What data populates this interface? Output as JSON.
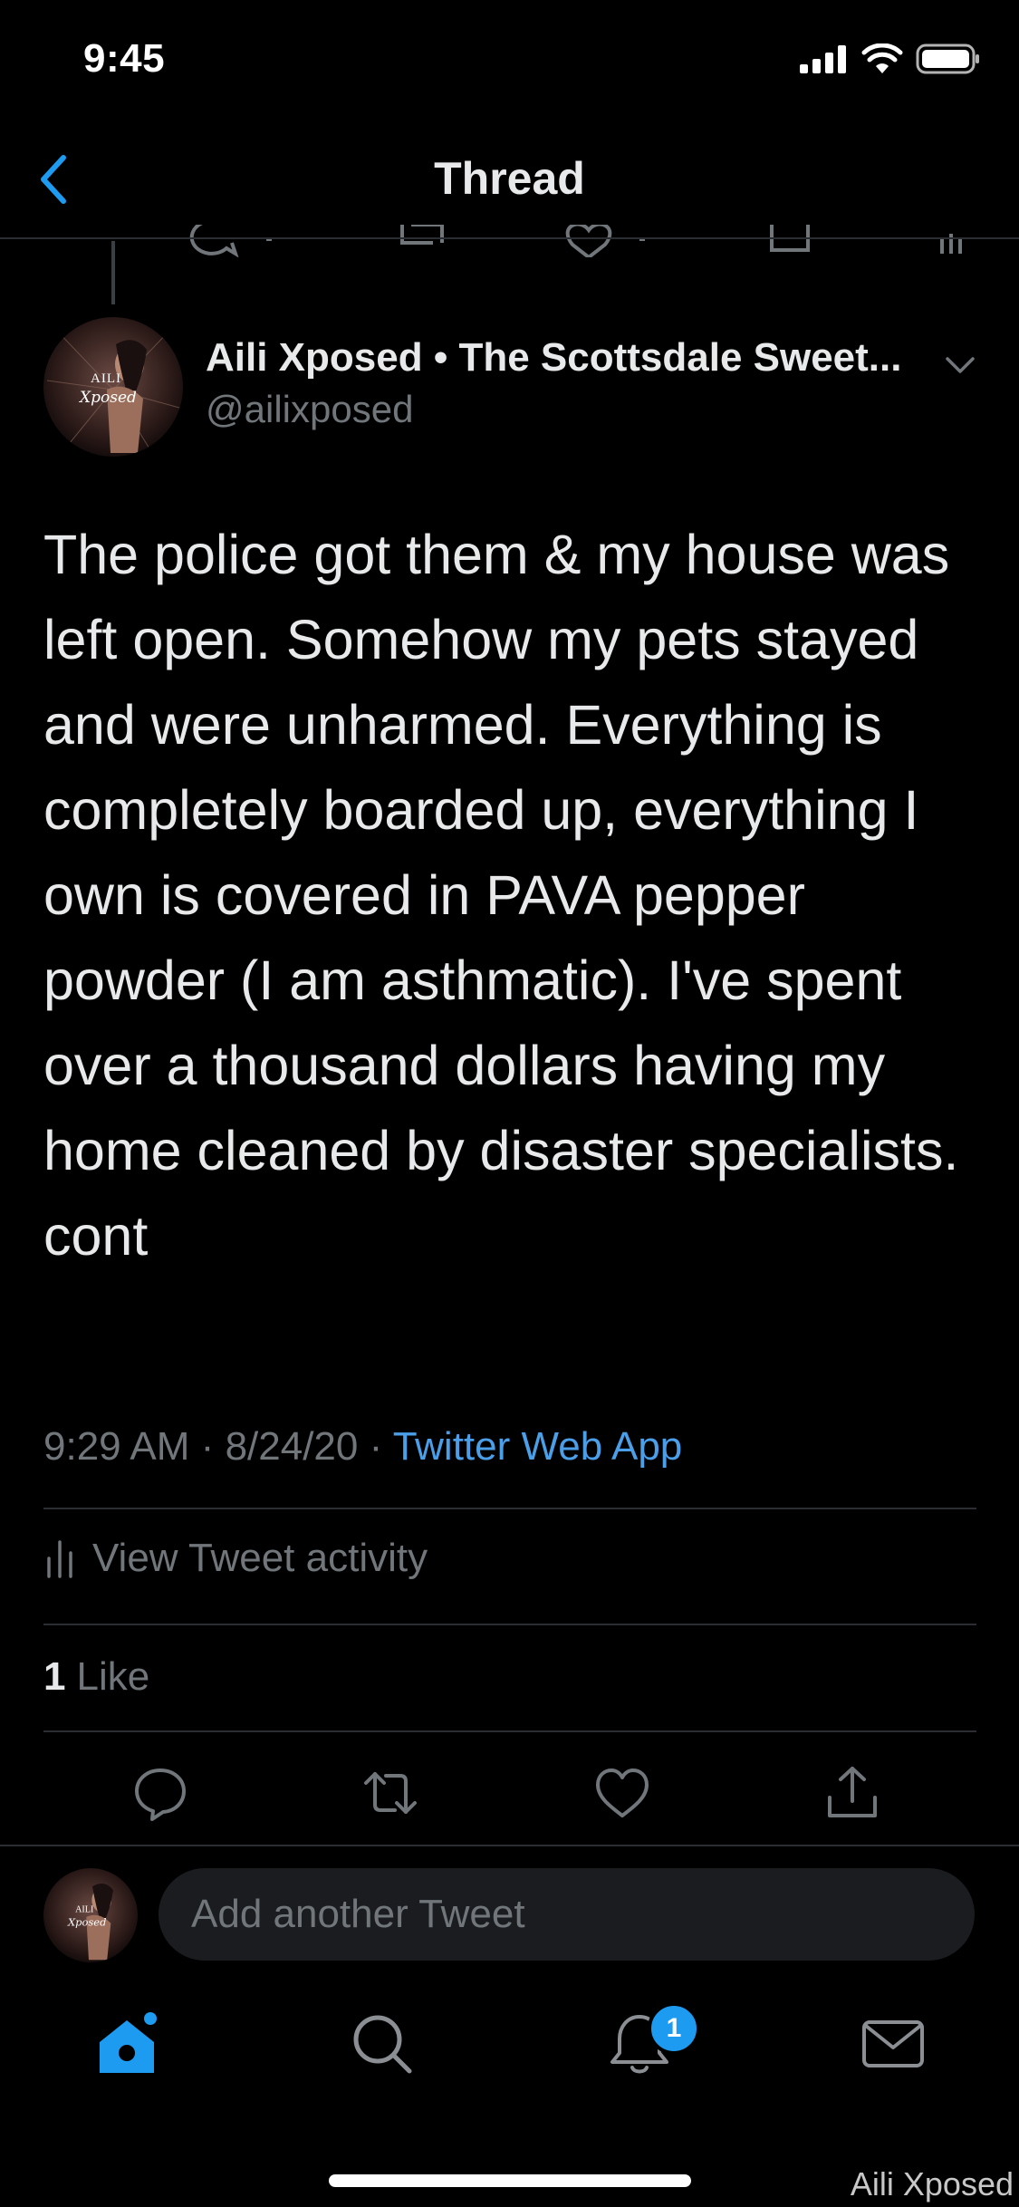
{
  "status": {
    "time": "9:45"
  },
  "nav": {
    "title": "Thread"
  },
  "tweet": {
    "author_name": "Aili Xposed • The Scottsdale Sweet...",
    "author_handle": "@ailixposed",
    "avatar_text_top": "AILI",
    "avatar_text_bottom": "Xposed",
    "body": "The police got them & my house was left open. Somehow my pets stayed and were unharmed. Everything is completely boarded up, everything I own is covered in PAVA pepper powder (I am asthmatic). I've spent over a thousand dollars having my home cleaned by disaster specialists.\ncont",
    "time": "9:29 AM",
    "separator": "·",
    "date": "8/24/20",
    "source": "Twitter Web App",
    "activity_label": "View Tweet activity",
    "like_count": "1",
    "like_label": "Like"
  },
  "composer": {
    "placeholder": "Add another Tweet"
  },
  "tabbar": {
    "notification_count": "1"
  },
  "watermark": "Aili Xposed",
  "colors": {
    "accent": "#1d9bf0",
    "link": "#4a9fe8",
    "muted": "#71767b",
    "background": "#000000"
  },
  "icons": [
    "back-chevron-icon",
    "signal-icon",
    "wifi-icon",
    "battery-icon",
    "chevron-down-icon",
    "activity-bars-icon",
    "reply-icon",
    "retweet-icon",
    "like-icon",
    "share-icon",
    "home-icon",
    "search-icon",
    "bell-icon",
    "mail-icon"
  ]
}
